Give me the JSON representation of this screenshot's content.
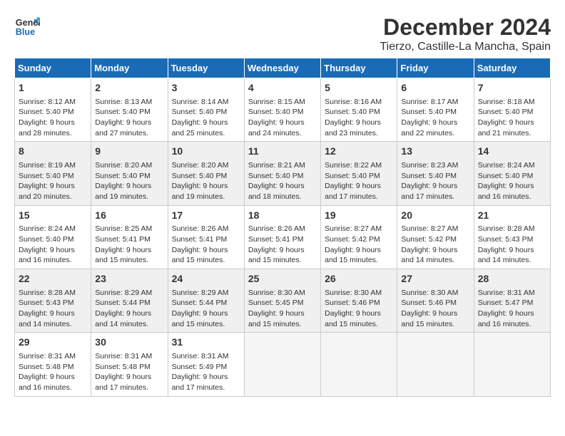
{
  "logo": {
    "line1": "General",
    "line2": "Blue"
  },
  "title": "December 2024",
  "subtitle": "Tierzo, Castille-La Mancha, Spain",
  "days_header": [
    "Sunday",
    "Monday",
    "Tuesday",
    "Wednesday",
    "Thursday",
    "Friday",
    "Saturday"
  ],
  "weeks": [
    [
      {
        "num": "1",
        "info": "Sunrise: 8:12 AM\nSunset: 5:40 PM\nDaylight: 9 hours\nand 28 minutes."
      },
      {
        "num": "2",
        "info": "Sunrise: 8:13 AM\nSunset: 5:40 PM\nDaylight: 9 hours\nand 27 minutes."
      },
      {
        "num": "3",
        "info": "Sunrise: 8:14 AM\nSunset: 5:40 PM\nDaylight: 9 hours\nand 25 minutes."
      },
      {
        "num": "4",
        "info": "Sunrise: 8:15 AM\nSunset: 5:40 PM\nDaylight: 9 hours\nand 24 minutes."
      },
      {
        "num": "5",
        "info": "Sunrise: 8:16 AM\nSunset: 5:40 PM\nDaylight: 9 hours\nand 23 minutes."
      },
      {
        "num": "6",
        "info": "Sunrise: 8:17 AM\nSunset: 5:40 PM\nDaylight: 9 hours\nand 22 minutes."
      },
      {
        "num": "7",
        "info": "Sunrise: 8:18 AM\nSunset: 5:40 PM\nDaylight: 9 hours\nand 21 minutes."
      }
    ],
    [
      {
        "num": "8",
        "info": "Sunrise: 8:19 AM\nSunset: 5:40 PM\nDaylight: 9 hours\nand 20 minutes."
      },
      {
        "num": "9",
        "info": "Sunrise: 8:20 AM\nSunset: 5:40 PM\nDaylight: 9 hours\nand 19 minutes."
      },
      {
        "num": "10",
        "info": "Sunrise: 8:20 AM\nSunset: 5:40 PM\nDaylight: 9 hours\nand 19 minutes."
      },
      {
        "num": "11",
        "info": "Sunrise: 8:21 AM\nSunset: 5:40 PM\nDaylight: 9 hours\nand 18 minutes."
      },
      {
        "num": "12",
        "info": "Sunrise: 8:22 AM\nSunset: 5:40 PM\nDaylight: 9 hours\nand 17 minutes."
      },
      {
        "num": "13",
        "info": "Sunrise: 8:23 AM\nSunset: 5:40 PM\nDaylight: 9 hours\nand 17 minutes."
      },
      {
        "num": "14",
        "info": "Sunrise: 8:24 AM\nSunset: 5:40 PM\nDaylight: 9 hours\nand 16 minutes."
      }
    ],
    [
      {
        "num": "15",
        "info": "Sunrise: 8:24 AM\nSunset: 5:40 PM\nDaylight: 9 hours\nand 16 minutes."
      },
      {
        "num": "16",
        "info": "Sunrise: 8:25 AM\nSunset: 5:41 PM\nDaylight: 9 hours\nand 15 minutes."
      },
      {
        "num": "17",
        "info": "Sunrise: 8:26 AM\nSunset: 5:41 PM\nDaylight: 9 hours\nand 15 minutes."
      },
      {
        "num": "18",
        "info": "Sunrise: 8:26 AM\nSunset: 5:41 PM\nDaylight: 9 hours\nand 15 minutes."
      },
      {
        "num": "19",
        "info": "Sunrise: 8:27 AM\nSunset: 5:42 PM\nDaylight: 9 hours\nand 15 minutes."
      },
      {
        "num": "20",
        "info": "Sunrise: 8:27 AM\nSunset: 5:42 PM\nDaylight: 9 hours\nand 14 minutes."
      },
      {
        "num": "21",
        "info": "Sunrise: 8:28 AM\nSunset: 5:43 PM\nDaylight: 9 hours\nand 14 minutes."
      }
    ],
    [
      {
        "num": "22",
        "info": "Sunrise: 8:28 AM\nSunset: 5:43 PM\nDaylight: 9 hours\nand 14 minutes."
      },
      {
        "num": "23",
        "info": "Sunrise: 8:29 AM\nSunset: 5:44 PM\nDaylight: 9 hours\nand 14 minutes."
      },
      {
        "num": "24",
        "info": "Sunrise: 8:29 AM\nSunset: 5:44 PM\nDaylight: 9 hours\nand 15 minutes."
      },
      {
        "num": "25",
        "info": "Sunrise: 8:30 AM\nSunset: 5:45 PM\nDaylight: 9 hours\nand 15 minutes."
      },
      {
        "num": "26",
        "info": "Sunrise: 8:30 AM\nSunset: 5:46 PM\nDaylight: 9 hours\nand 15 minutes."
      },
      {
        "num": "27",
        "info": "Sunrise: 8:30 AM\nSunset: 5:46 PM\nDaylight: 9 hours\nand 15 minutes."
      },
      {
        "num": "28",
        "info": "Sunrise: 8:31 AM\nSunset: 5:47 PM\nDaylight: 9 hours\nand 16 minutes."
      }
    ],
    [
      {
        "num": "29",
        "info": "Sunrise: 8:31 AM\nSunset: 5:48 PM\nDaylight: 9 hours\nand 16 minutes."
      },
      {
        "num": "30",
        "info": "Sunrise: 8:31 AM\nSunset: 5:48 PM\nDaylight: 9 hours\nand 17 minutes."
      },
      {
        "num": "31",
        "info": "Sunrise: 8:31 AM\nSunset: 5:49 PM\nDaylight: 9 hours\nand 17 minutes."
      },
      {
        "num": "",
        "info": ""
      },
      {
        "num": "",
        "info": ""
      },
      {
        "num": "",
        "info": ""
      },
      {
        "num": "",
        "info": ""
      }
    ]
  ]
}
